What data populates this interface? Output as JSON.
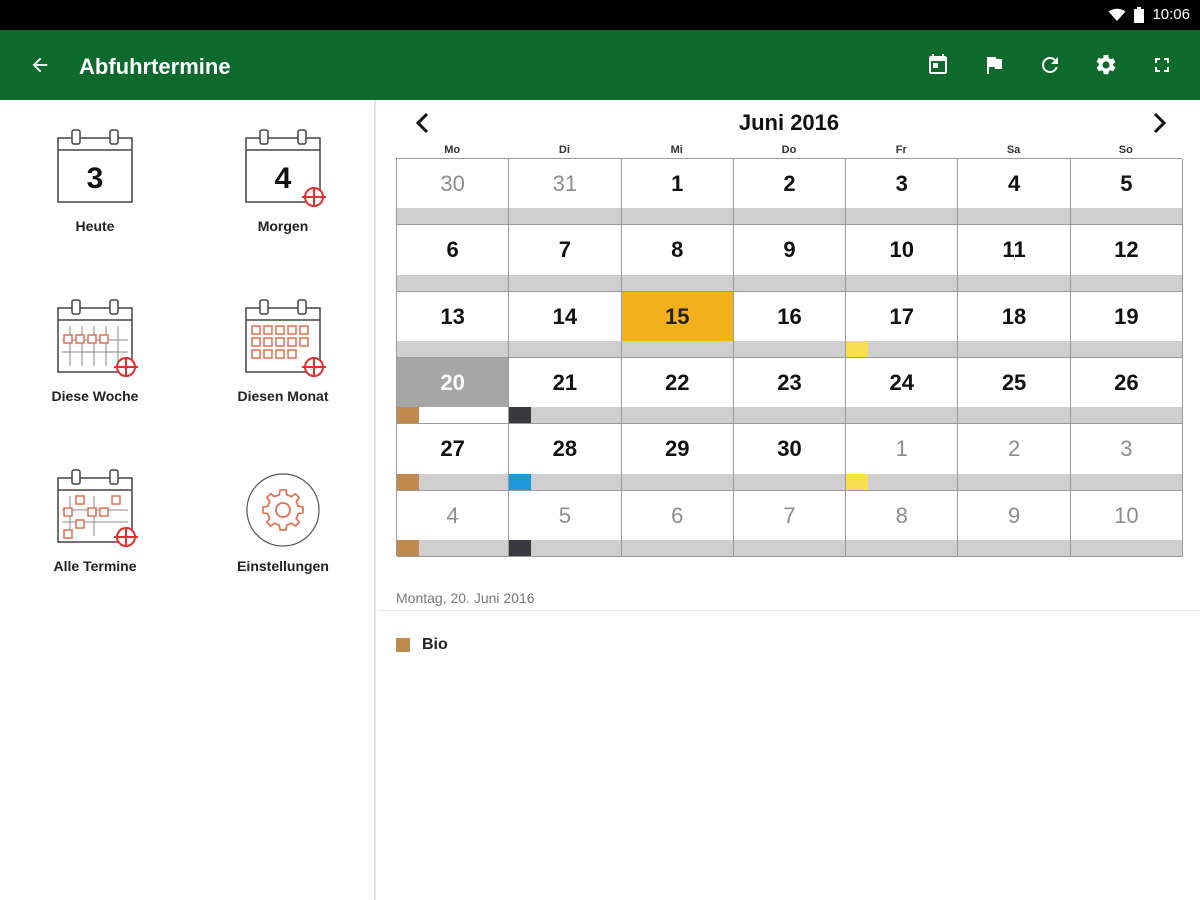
{
  "status_bar": {
    "time": "10:06"
  },
  "app_bar": {
    "title": "Abfuhrtermine"
  },
  "menu": {
    "today": {
      "label": "Heute",
      "day": "3"
    },
    "tomorrow": {
      "label": "Morgen",
      "day": "4"
    },
    "this_week": {
      "label": "Diese Woche"
    },
    "this_month": {
      "label": "Diesen Monat"
    },
    "all_dates": {
      "label": "Alle Termine"
    },
    "settings": {
      "label": "Einstellungen"
    }
  },
  "calendar": {
    "month_title": "Juni 2016",
    "weekdays": [
      "Mo",
      "Di",
      "Mi",
      "Do",
      "Fr",
      "Sa",
      "So"
    ],
    "today_day": "15",
    "selected_day": "20",
    "waste_colors": {
      "bio": "#c08a4c",
      "rest": "#3a3a3e",
      "paper": "#1a9ad8",
      "yellow": "#f6e04d"
    },
    "weeks": [
      [
        {
          "d": "30",
          "other": true
        },
        {
          "d": "31",
          "other": true
        },
        {
          "d": "1"
        },
        {
          "d": "2"
        },
        {
          "d": "3"
        },
        {
          "d": "4"
        },
        {
          "d": "5"
        }
      ],
      [
        {
          "d": "6"
        },
        {
          "d": "7"
        },
        {
          "d": "8"
        },
        {
          "d": "9"
        },
        {
          "d": "10"
        },
        {
          "d": "11"
        },
        {
          "d": "12"
        }
      ],
      [
        {
          "d": "13"
        },
        {
          "d": "14"
        },
        {
          "d": "15",
          "state": "today"
        },
        {
          "d": "16"
        },
        {
          "d": "17",
          "mark": "yellow"
        },
        {
          "d": "18"
        },
        {
          "d": "19"
        }
      ],
      [
        {
          "d": "20",
          "state": "selected",
          "mark": "bio"
        },
        {
          "d": "21",
          "mark": "rest"
        },
        {
          "d": "22"
        },
        {
          "d": "23"
        },
        {
          "d": "24"
        },
        {
          "d": "25"
        },
        {
          "d": "26"
        }
      ],
      [
        {
          "d": "27",
          "mark": "bio"
        },
        {
          "d": "28",
          "mark": "paper"
        },
        {
          "d": "29"
        },
        {
          "d": "30"
        },
        {
          "d": "1",
          "other": true,
          "mark": "yellow"
        },
        {
          "d": "2",
          "other": true
        },
        {
          "d": "3",
          "other": true
        }
      ],
      [
        {
          "d": "4",
          "other": true,
          "mark": "bio"
        },
        {
          "d": "5",
          "other": true,
          "mark": "rest"
        },
        {
          "d": "6",
          "other": true
        },
        {
          "d": "7",
          "other": true
        },
        {
          "d": "8",
          "other": true
        },
        {
          "d": "9",
          "other": true
        },
        {
          "d": "10",
          "other": true
        }
      ]
    ]
  },
  "detail": {
    "date_label": "Montag, 20. Juni 2016",
    "items": [
      {
        "label": "Bio",
        "color": "#c08a4c"
      }
    ]
  }
}
